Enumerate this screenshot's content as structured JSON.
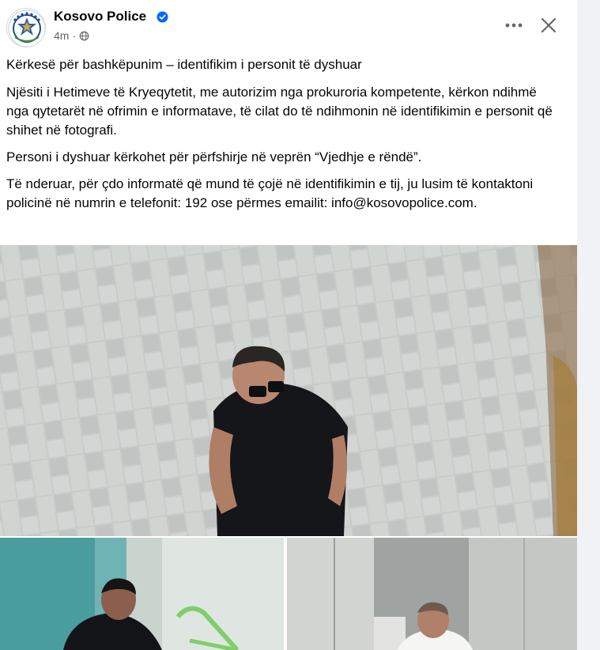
{
  "post": {
    "author": "Kosovo Police",
    "verified": true,
    "time": "4m",
    "privacy_icon": "globe-icon",
    "paragraphs": [
      "Kërkesë për bashkëpunim – identifikim i personit të dyshuar",
      "Njësiti i Hetimeve të Kryeqytetit, me autorizim nga prokuroria kompetente, kërkon ndihmë nga qytetarët në ofrimin e informatave, të cilat do të ndihmonin në identifikimin e personit që shihet në fotografi.",
      "Personi i dyshuar kërkohet për përfshirje në veprën “Vjedhje e rëndë”.",
      "Të nderuar, për çdo informatë që mund të çojë në identifikimin e tij, ju lusim të kontaktoni policinë në numrin e telefonit: 192 ose përmes emailit: info@kosovopolice.com."
    ]
  },
  "colors": {
    "verified_badge": "#0866ff",
    "secondary_text": "#65676b",
    "primary_text": "#050505",
    "background": "#f0f2f5"
  },
  "icons": {
    "more": "more-options-icon",
    "close": "close-icon",
    "verified": "verified-badge-icon"
  }
}
